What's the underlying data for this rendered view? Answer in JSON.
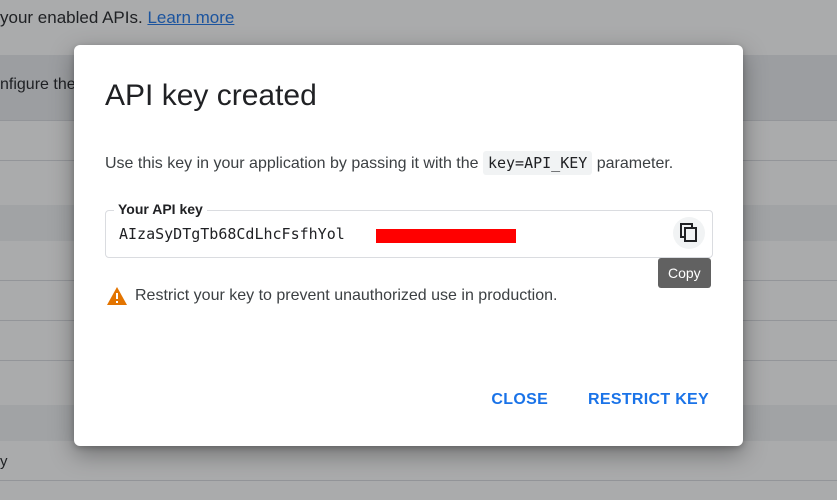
{
  "background": {
    "line1_text": "your enabled APIs. ",
    "line1_link": "Learn more",
    "line2_text": "nfigure the",
    "line3_text": "y"
  },
  "dialog": {
    "title": "API key created",
    "desc_before": "Use this key in your application by passing it with the ",
    "desc_code": "key=API_KEY",
    "desc_after": " parameter.",
    "key_label": "Your API key",
    "key_value": "AIzaSyDTgTb68CdLhcFsfhYol",
    "copy_tooltip": "Copy",
    "warning_text": "Restrict your key to prevent unauthorized use in production.",
    "close_label": "CLOSE",
    "restrict_label": "RESTRICT KEY"
  },
  "colors": {
    "accent": "#1a73e8",
    "warning": "#e37400",
    "redaction": "#ff0000"
  },
  "icons": {
    "copy": "copy-icon",
    "warning": "warning-icon"
  }
}
